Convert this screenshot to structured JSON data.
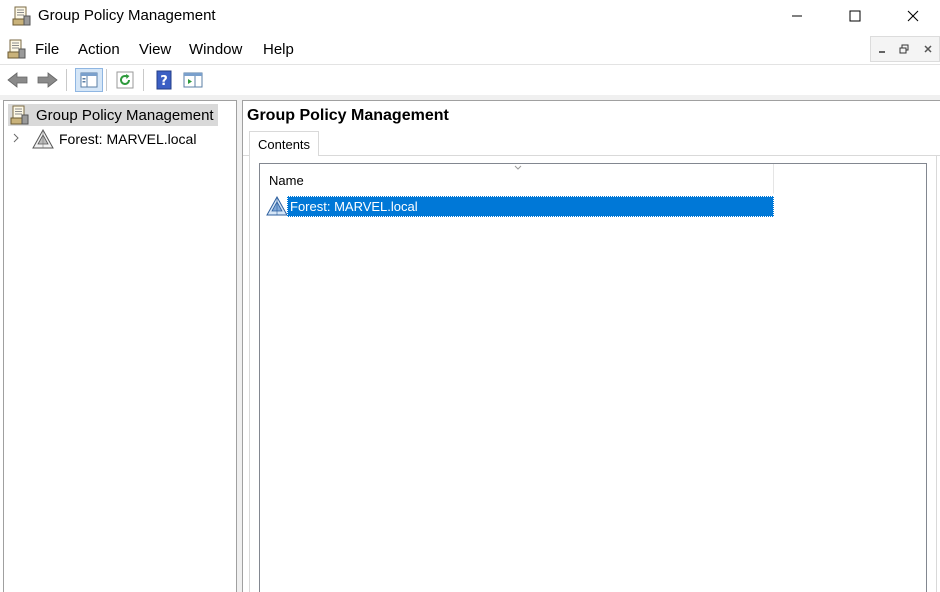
{
  "window": {
    "title": "Group Policy Management"
  },
  "menu": {
    "items": [
      "File",
      "Action",
      "View",
      "Window",
      "Help"
    ]
  },
  "tree": {
    "root_label": "Group Policy Management",
    "child_label": "Forest: MARVEL.local"
  },
  "content": {
    "title": "Group Policy Management",
    "tab_label": "Contents",
    "column_name": "Name",
    "rows": [
      {
        "name": "Forest: MARVEL.local",
        "selected": true
      }
    ]
  },
  "colors": {
    "selection": "#0078d7",
    "tree_selected_bg": "#d9d9d9"
  },
  "icons": {
    "app": "gpmc-icon",
    "forest": "forest-icon",
    "back": "back-arrow-icon",
    "forward": "forward-arrow-icon",
    "tree_toggle": "show-hide-tree-icon",
    "refresh": "refresh-icon",
    "help": "help-icon",
    "properties": "properties-icon"
  }
}
